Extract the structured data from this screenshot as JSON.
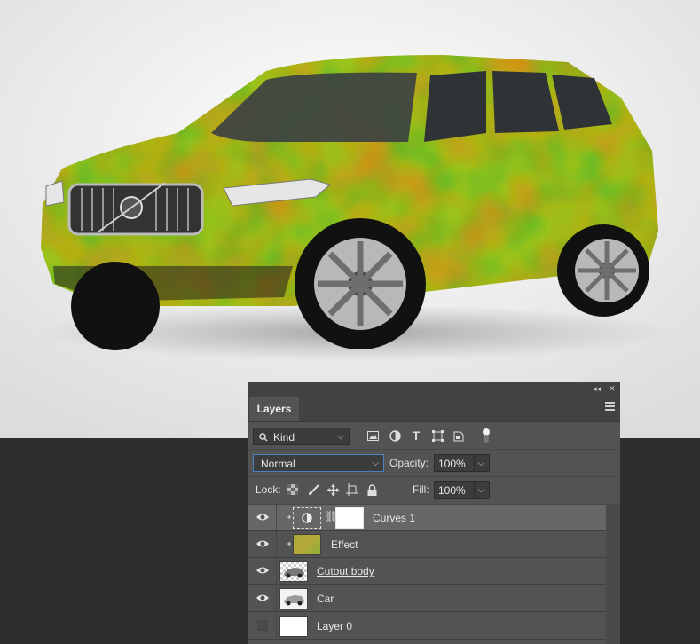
{
  "colors": {
    "panel_bg": "#535353",
    "selected_layer": "#676767",
    "dark_bg": "#2e2e2e",
    "canvas_bg": "#ececec",
    "car_green": "#5cb82a",
    "car_orange": "#e08a10",
    "car_yellow": "#d6c414"
  },
  "panel": {
    "tab_label": "Layers",
    "collapse_icon": "double-chevron-left-icon",
    "close_icon": "close-x-icon",
    "menu_icon": "hamburger-menu-icon"
  },
  "filter": {
    "kind_label": "Kind",
    "icons": [
      "image-filter-icon",
      "adjustment-filter-icon",
      "type-filter-icon",
      "shape-filter-icon",
      "smart-object-filter-icon",
      "filter-toggle-icon"
    ]
  },
  "blend": {
    "mode": "Normal",
    "opacity_label": "Opacity:",
    "opacity_value": "100%"
  },
  "lock": {
    "label": "Lock:",
    "icons": [
      "lock-transparent-icon",
      "lock-paint-icon",
      "lock-position-icon",
      "lock-artboard-icon",
      "lock-all-icon"
    ],
    "fill_label": "Fill:",
    "fill_value": "100%"
  },
  "layers": [
    {
      "name": "Curves 1",
      "visible": true,
      "selected": true,
      "clipped": true,
      "thumb": "curves-adjustment",
      "has_mask": true
    },
    {
      "name": "Effect",
      "visible": true,
      "selected": false,
      "clipped": true,
      "thumb": "camo-texture"
    },
    {
      "name": "Cutout body",
      "visible": true,
      "selected": false,
      "clipped": false,
      "thumb": "car-cutout"
    },
    {
      "name": "Car",
      "visible": true,
      "selected": false,
      "clipped": false,
      "thumb": "car-photo"
    },
    {
      "name": "Layer 0",
      "visible": false,
      "selected": false,
      "clipped": false,
      "thumb": "white"
    }
  ]
}
